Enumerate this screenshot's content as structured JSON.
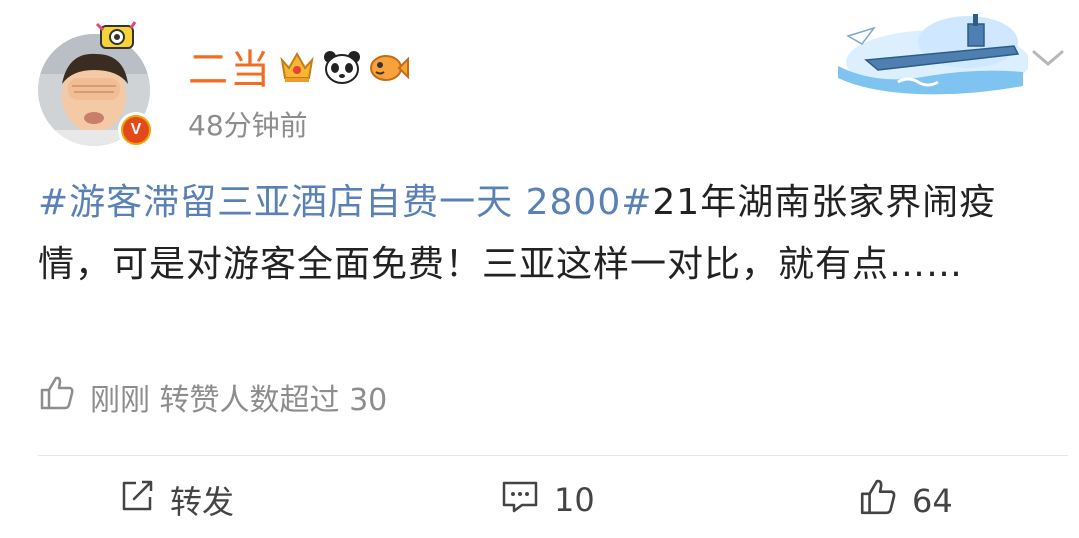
{
  "post": {
    "author": {
      "name": "二当",
      "verified_badge": "V"
    },
    "timestamp": "48分钟前",
    "topic": "#游客滞留三亚酒店自费一天 2800#",
    "text": "21年湖南张家界闹疫情，可是对游客全面免费！三亚这样一对比，就有点……",
    "like_summary": "刚刚 转赞人数超过 30"
  },
  "actions": {
    "repost_label": "转发",
    "comment_count": "10",
    "like_count": "64"
  },
  "colors": {
    "username": "#f26d21",
    "topic_link": "#5a81b6",
    "muted": "#8d8d8d"
  },
  "icons": [
    "crown-icon",
    "panda-icon",
    "fish-icon",
    "thumbs-up-icon",
    "edit-icon",
    "comment-icon",
    "chevron-down-icon"
  ]
}
